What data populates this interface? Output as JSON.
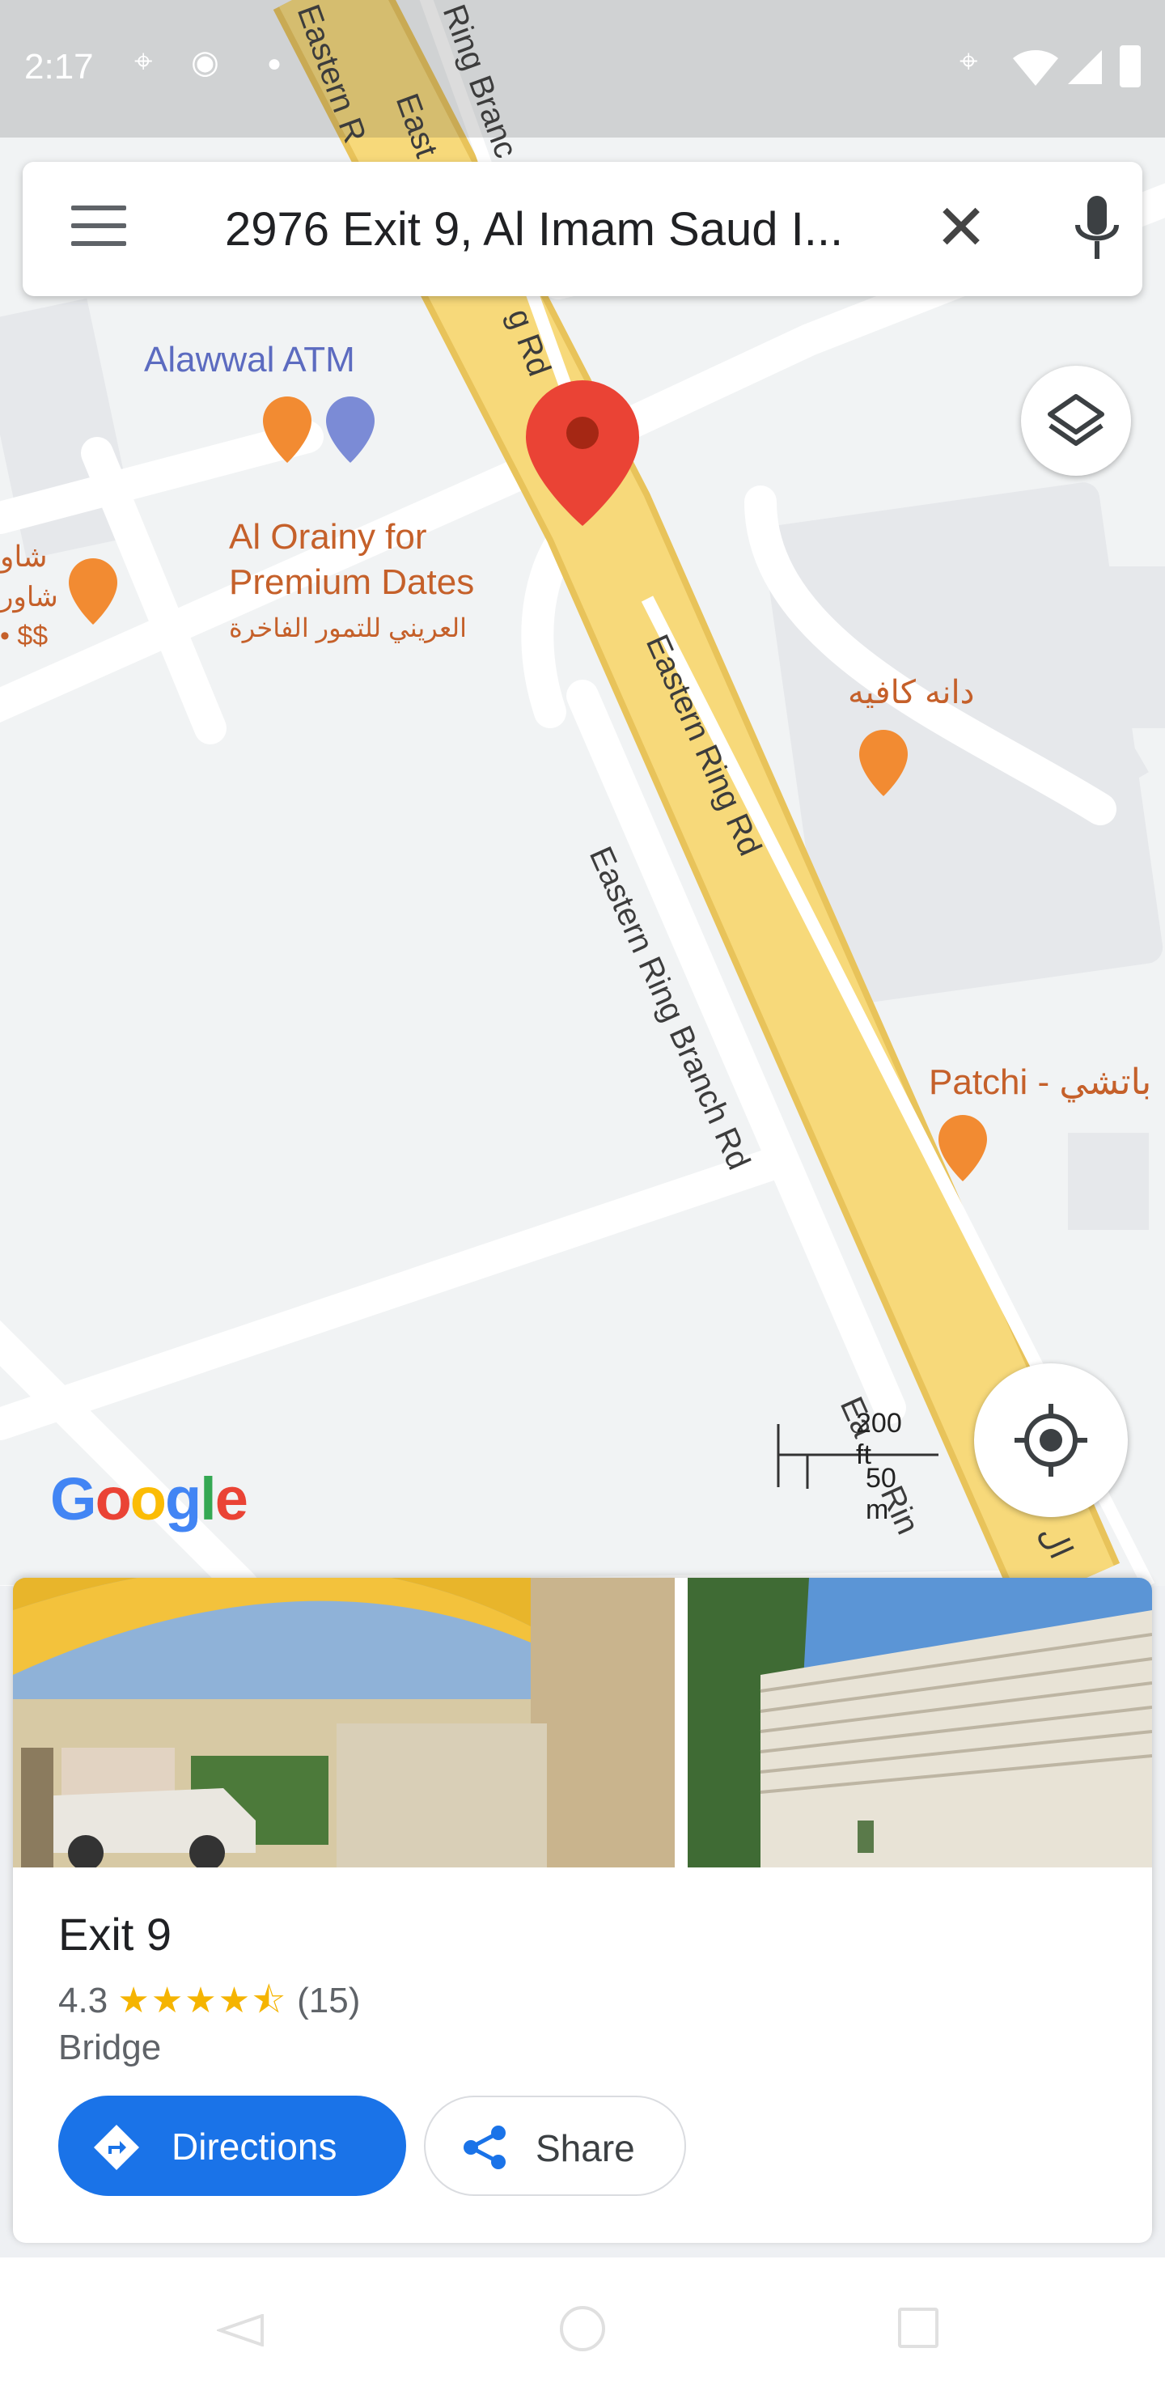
{
  "status_bar": {
    "time": "2:17"
  },
  "search": {
    "query": "2976 Exit 9, Al Imam Saud I...",
    "menu_icon": "menu-icon",
    "clear_icon": "close-icon",
    "mic_icon": "mic-icon"
  },
  "map": {
    "labels": {
      "atm": "Alawwal ATM",
      "dates_line1": "Al Orainy for",
      "dates_line2": "Premium Dates",
      "dates_arabic": "العريني للتمور الفاخرة",
      "cafe": "دانه كافيه",
      "patchi": "Patchi - باتشي",
      "left_arabic1": "شاو",
      "left_arabic2": "شاور",
      "left_price": "• $$",
      "road_eastern_ring": "Eastern Ring Rd",
      "road_branch": "Eastern Ring Branch Rd",
      "road_top_1": "Eastern R",
      "road_top_2": "East",
      "road_top_3": "Ring Branc",
      "road_top_4": "g Rd",
      "road_bottom_1": "Ea",
      "road_bottom_2": "Rin",
      "road_bottom_3": "ال"
    },
    "scale": {
      "imperial": "200 ft",
      "metric": "50 m"
    },
    "logo": "Google",
    "colors": {
      "road_major": "#f7d97a",
      "road_major_edge": "#e8c35a",
      "poi": "#f28b32",
      "pin": "#ea4335",
      "accent": "#1a73e8"
    }
  },
  "place": {
    "name": "Exit 9",
    "rating": "4.3",
    "stars": "★★★★",
    "reviews": "(15)",
    "type": "Bridge",
    "directions_label": "Directions",
    "share_label": "Share"
  }
}
